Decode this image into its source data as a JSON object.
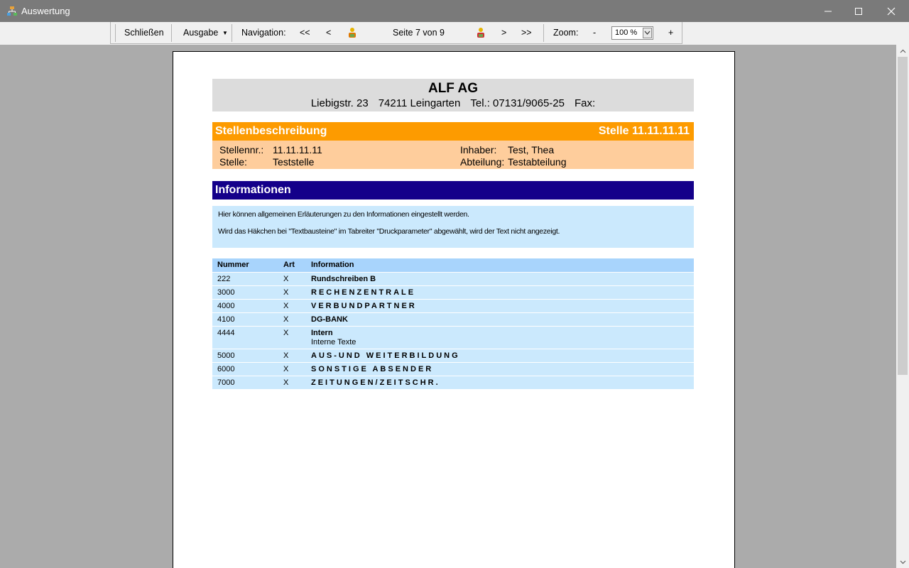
{
  "window": {
    "title": "Auswertung"
  },
  "toolbar": {
    "close_label": "Schließen",
    "output_label": "Ausgabe",
    "navigation_label": "Navigation:",
    "first_label": "<<",
    "prev_label": "<",
    "page_info": "Seite 7 von 9",
    "next_label": ">",
    "last_label": ">>",
    "zoom_label": "Zoom:",
    "zoom_out_label": "-",
    "zoom_value": "100 %",
    "zoom_in_label": "+"
  },
  "report": {
    "company_name": "ALF AG",
    "street": "Liebigstr. 23",
    "city": "74211 Leingarten",
    "phone": "Tel.: 07131/9065-25",
    "fax": "Fax:",
    "section_title": "Stellenbeschreibung",
    "position_header": "Stelle 11.11.11.11",
    "fields": {
      "stellennr_label": "Stellennr.:",
      "stellennr_value": "11.11.11.11",
      "stelle_label": "Stelle:",
      "stelle_value": "Teststelle",
      "inhaber_label": "Inhaber:",
      "inhaber_value": "Test, Thea",
      "abteilung_label": "Abteilung:",
      "abteilung_value": "Testabteilung"
    },
    "info_title": "Informationen",
    "info_text_1": "Hier können allgemeinen Erläuterungen zu den Informationen eingestellt werden.",
    "info_text_2": "Wird das Häkchen bei \"Textbausteine\" im Tabreiter \"Druckparameter\" abgewählt, wird der Text nicht angezeigt.",
    "table": {
      "headers": [
        "Nummer",
        "Art",
        "Information"
      ],
      "rows": [
        {
          "nummer": "222",
          "art": "X",
          "info": "Rundschreiben B",
          "sub": ""
        },
        {
          "nummer": "3000",
          "art": "X",
          "info": "RECHENZENTRALE",
          "sub": ""
        },
        {
          "nummer": "4000",
          "art": "X",
          "info": "VERBUNDPARTNER",
          "sub": ""
        },
        {
          "nummer": "4100",
          "art": "X",
          "info": "DG-BANK",
          "sub": ""
        },
        {
          "nummer": "4444",
          "art": "X",
          "info": "Intern",
          "sub": "Interne Texte"
        },
        {
          "nummer": "5000",
          "art": "X",
          "info": "AUS-UND WEITERBILDUNG",
          "sub": ""
        },
        {
          "nummer": "6000",
          "art": "X",
          "info": "SONSTIGE ABSENDER",
          "sub": ""
        },
        {
          "nummer": "7000",
          "art": "X",
          "info": "ZEITUNGEN/ZEITSCHR.",
          "sub": ""
        }
      ]
    }
  },
  "icons": {
    "app": "app-icon",
    "minimize": "minimize-icon",
    "maximize": "maximize-icon",
    "close": "close-icon",
    "search_prev": "person-search-prev-icon",
    "search_next": "person-search-next-icon"
  }
}
